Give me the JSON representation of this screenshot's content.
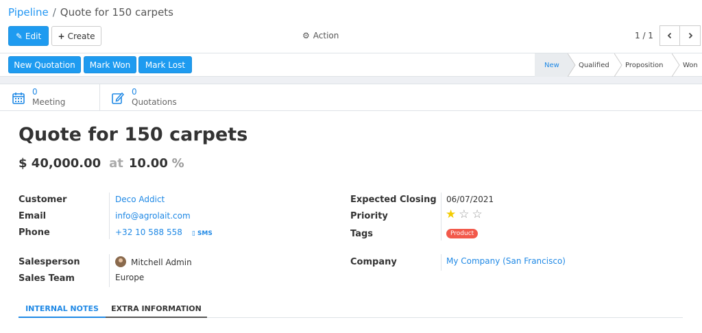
{
  "breadcrumb": {
    "parent": "Pipeline",
    "separator": "/",
    "current": "Quote for 150 carpets"
  },
  "toolbar": {
    "edit_label": "Edit",
    "create_label": "Create",
    "action_label": "Action"
  },
  "pager": {
    "value": "1 / 1"
  },
  "header": {
    "buttons": {
      "new_quotation": "New Quotation",
      "mark_won": "Mark Won",
      "mark_lost": "Mark Lost"
    },
    "stages": [
      "New",
      "Qualified",
      "Proposition",
      "Won"
    ],
    "active_stage": "New"
  },
  "stats": {
    "meeting": {
      "value": "0",
      "label": "Meeting"
    },
    "quotations": {
      "value": "0",
      "label": "Quotations"
    }
  },
  "form": {
    "title": "Quote for 150 carpets",
    "revenue": "$ 40,000.00",
    "at": "at",
    "probability": "10.00",
    "percent": "%",
    "left": {
      "customer_label": "Customer",
      "customer_value": "Deco Addict",
      "email_label": "Email",
      "email_value": "info@agrolait.com",
      "phone_label": "Phone",
      "phone_value": "+32 10 588 558",
      "sms_label": "SMS",
      "salesperson_label": "Salesperson",
      "salesperson_value": "Mitchell Admin",
      "sales_team_label": "Sales Team",
      "sales_team_value": "Europe"
    },
    "right": {
      "closing_label": "Expected Closing",
      "closing_value": "06/07/2021",
      "priority_label": "Priority",
      "priority_stars": 1,
      "priority_max": 3,
      "tags_label": "Tags",
      "tag": "Product",
      "company_label": "Company",
      "company_value": "My Company (San Francisco)"
    }
  },
  "tabs": {
    "internal_notes": "INTERNAL NOTES",
    "extra_information": "EXTRA INFORMATION"
  },
  "colors": {
    "primary": "#1e9bf0",
    "link": "#1e88e5",
    "tag": "#f2594b",
    "star": "#f3cc00"
  }
}
